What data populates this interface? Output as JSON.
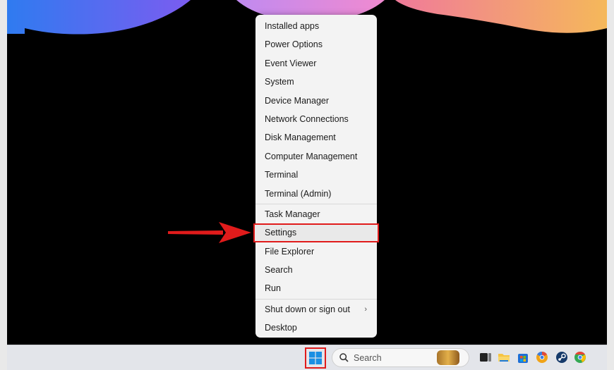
{
  "context_menu": {
    "items": [
      {
        "label": "Installed apps"
      },
      {
        "label": "Power Options"
      },
      {
        "label": "Event Viewer"
      },
      {
        "label": "System"
      },
      {
        "label": "Device Manager"
      },
      {
        "label": "Network Connections"
      },
      {
        "label": "Disk Management"
      },
      {
        "label": "Computer Management"
      },
      {
        "label": "Terminal"
      },
      {
        "label": "Terminal (Admin)"
      },
      {
        "label": "Task Manager"
      },
      {
        "label": "Settings",
        "highlighted": true
      },
      {
        "label": "File Explorer"
      },
      {
        "label": "Search"
      },
      {
        "label": "Run"
      },
      {
        "label": "Shut down or sign out",
        "has_submenu": true
      },
      {
        "label": "Desktop"
      }
    ],
    "submenu_glyph": "›"
  },
  "taskbar": {
    "search_placeholder": "Search",
    "pinned_icons": [
      "task-view-icon",
      "file-explorer-icon",
      "microsoft-store-icon",
      "chrome-canary-icon",
      "steam-icon",
      "chrome-icon"
    ]
  },
  "colors": {
    "highlight_red": "#e01b1b",
    "menu_background": "#f3f3f3",
    "taskbar_background": "#e3e5ea"
  }
}
